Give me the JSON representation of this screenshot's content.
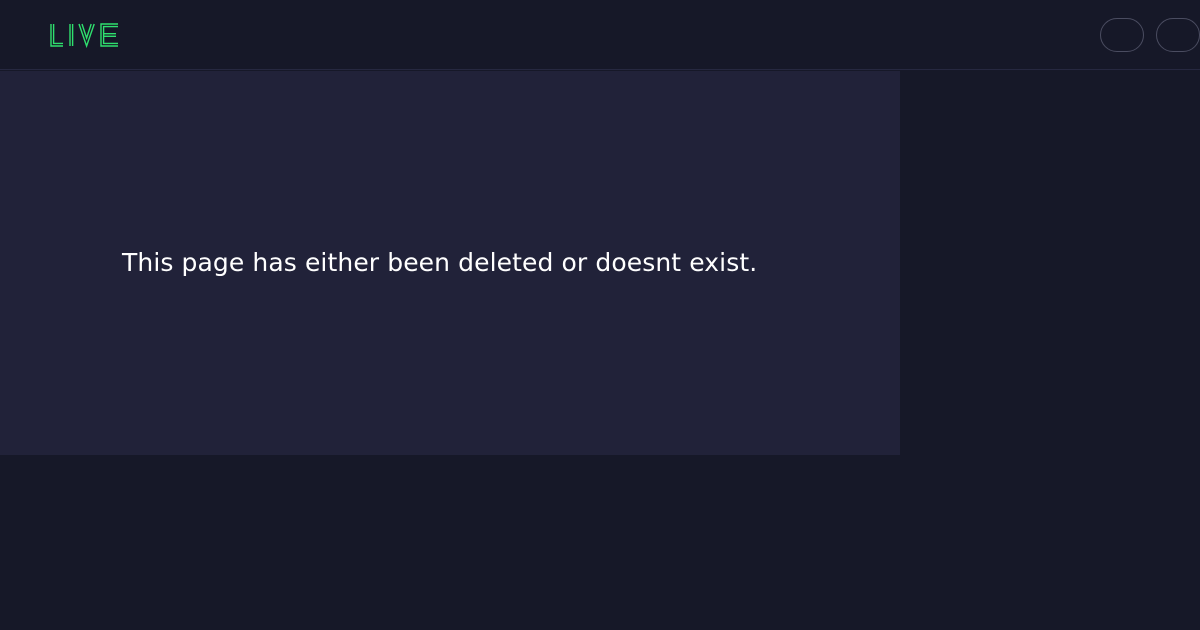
{
  "header": {
    "logo_text": "LIVE",
    "brand_color": "#2fe06e",
    "buttons": [
      {
        "label": ""
      },
      {
        "label": ""
      }
    ]
  },
  "main": {
    "message": "This page has either been deleted or doesnt exist."
  },
  "colors": {
    "background": "#161828",
    "panel": "#212239",
    "text": "#ffffff",
    "button_border": "#4a4c60"
  }
}
